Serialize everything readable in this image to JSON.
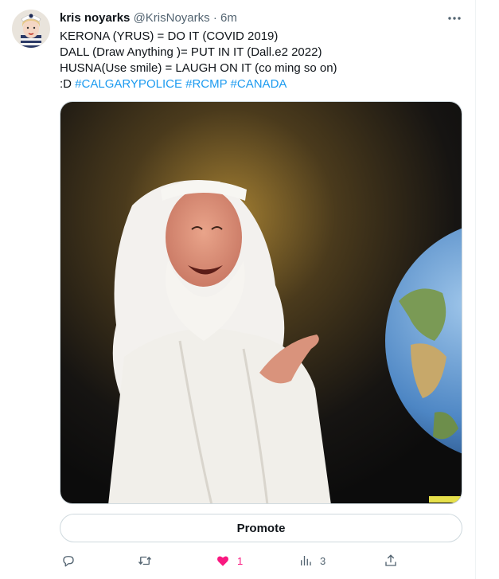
{
  "tweet": {
    "author_name": "kris noyarks",
    "author_handle": "@KrisNoyarks",
    "separator": "·",
    "time": "6m",
    "more_icon": "ellipsis-icon",
    "text_lines": [
      "KERONA (YRUS) = DO IT (COVID 2019)",
      "DALL (Draw Anything )= PUT IN IT (Dall.e2 2022)",
      "HUSNA(Use smile) = LAUGH ON IT (co ming so on)"
    ],
    "last_line_prefix": ":D",
    "hashtags": [
      "#CALGARYPOLICE",
      "#RCMP",
      "#CANADA"
    ],
    "promote_label": "Promote",
    "actions": {
      "reply": {
        "icon": "reply-icon",
        "count": ""
      },
      "retweet": {
        "icon": "retweet-icon",
        "count": ""
      },
      "like": {
        "icon": "heart-filled-icon",
        "count": "1"
      },
      "views": {
        "icon": "views-icon",
        "count": "3"
      },
      "share": {
        "icon": "share-icon",
        "count": ""
      }
    }
  },
  "colors": {
    "text": "#0f1419",
    "secondary": "#536471",
    "link": "#1d9bf0",
    "like": "#f91880",
    "border": "#cfd9de"
  }
}
